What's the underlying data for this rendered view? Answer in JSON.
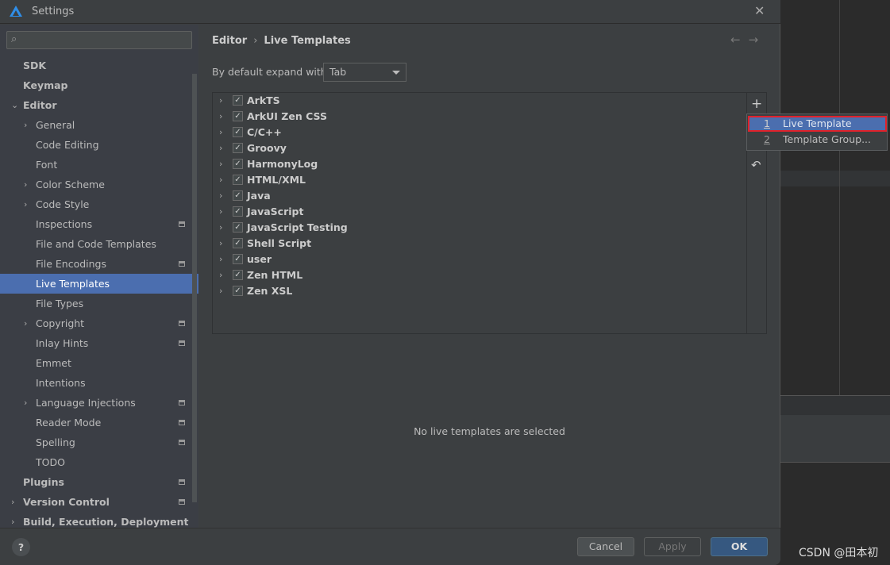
{
  "window": {
    "title": "Settings"
  },
  "sidebar": {
    "items": [
      {
        "label": "SDK",
        "level": 0,
        "bold": true,
        "chevron": "",
        "gear": false
      },
      {
        "label": "Keymap",
        "level": 0,
        "bold": true,
        "chevron": "",
        "gear": false
      },
      {
        "label": "Editor",
        "level": 0,
        "bold": true,
        "chevron": "down",
        "gear": false
      },
      {
        "label": "General",
        "level": 1,
        "chevron": "right",
        "gear": false
      },
      {
        "label": "Code Editing",
        "level": 1,
        "chevron": "",
        "gear": false
      },
      {
        "label": "Font",
        "level": 1,
        "chevron": "",
        "gear": false
      },
      {
        "label": "Color Scheme",
        "level": 1,
        "chevron": "right",
        "gear": false
      },
      {
        "label": "Code Style",
        "level": 1,
        "chevron": "right",
        "gear": false
      },
      {
        "label": "Inspections",
        "level": 1,
        "chevron": "",
        "gear": true
      },
      {
        "label": "File and Code Templates",
        "level": 1,
        "chevron": "",
        "gear": false
      },
      {
        "label": "File Encodings",
        "level": 1,
        "chevron": "",
        "gear": true
      },
      {
        "label": "Live Templates",
        "level": 1,
        "chevron": "",
        "gear": false,
        "selected": true
      },
      {
        "label": "File Types",
        "level": 1,
        "chevron": "",
        "gear": false
      },
      {
        "label": "Copyright",
        "level": 1,
        "chevron": "right",
        "gear": true
      },
      {
        "label": "Inlay Hints",
        "level": 1,
        "chevron": "",
        "gear": true
      },
      {
        "label": "Emmet",
        "level": 1,
        "chevron": "",
        "gear": false
      },
      {
        "label": "Intentions",
        "level": 1,
        "chevron": "",
        "gear": false
      },
      {
        "label": "Language Injections",
        "level": 1,
        "chevron": "right",
        "gear": true
      },
      {
        "label": "Reader Mode",
        "level": 1,
        "chevron": "",
        "gear": true
      },
      {
        "label": "Spelling",
        "level": 1,
        "chevron": "",
        "gear": true
      },
      {
        "label": "TODO",
        "level": 1,
        "chevron": "",
        "gear": false
      },
      {
        "label": "Plugins",
        "level": 0,
        "bold": true,
        "chevron": "",
        "gear": true
      },
      {
        "label": "Version Control",
        "level": 0,
        "bold": true,
        "chevron": "right",
        "gear": true
      },
      {
        "label": "Build, Execution, Deployment",
        "level": 0,
        "bold": true,
        "chevron": "right",
        "gear": false
      }
    ]
  },
  "main": {
    "breadcrumb": [
      "Editor",
      "Live Templates"
    ],
    "expand_label": "By default expand with",
    "expand_value": "Tab",
    "groups": [
      {
        "label": "ArkTS",
        "checked": true
      },
      {
        "label": "ArkUI Zen CSS",
        "checked": true
      },
      {
        "label": "C/C++",
        "checked": true
      },
      {
        "label": "Groovy",
        "checked": true
      },
      {
        "label": "HarmonyLog",
        "checked": true
      },
      {
        "label": "HTML/XML",
        "checked": true
      },
      {
        "label": "Java",
        "checked": true
      },
      {
        "label": "JavaScript",
        "checked": true
      },
      {
        "label": "JavaScript Testing",
        "checked": true
      },
      {
        "label": "Shell Script",
        "checked": true
      },
      {
        "label": "user",
        "checked": true
      },
      {
        "label": "Zen HTML",
        "checked": true
      },
      {
        "label": "Zen XSL",
        "checked": true
      }
    ],
    "empty_text": "No live templates are selected"
  },
  "popup": {
    "items": [
      {
        "num": "1",
        "label": "Live Template",
        "selected": true
      },
      {
        "num": "2",
        "label": "Template Group..."
      }
    ]
  },
  "footer": {
    "help": "?",
    "cancel": "Cancel",
    "apply": "Apply",
    "ok": "OK"
  },
  "watermark": "CSDN @田本初"
}
